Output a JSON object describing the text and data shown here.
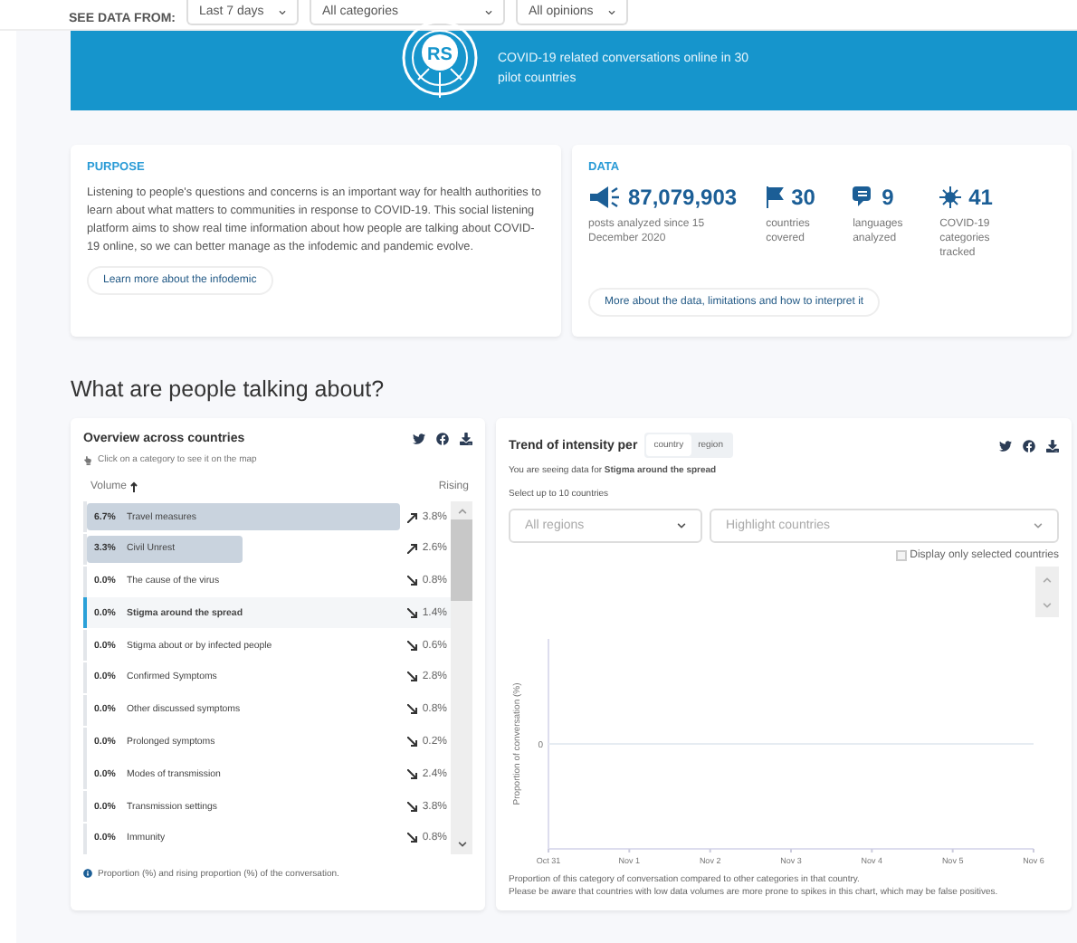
{
  "filter_bar": {
    "label": "SEE DATA FROM:",
    "dropdowns": [
      "Last 7 days",
      "All categories",
      "All opinions"
    ]
  },
  "banner": {
    "logo": "RS",
    "text": "COVID-19 related conversations online in 30 pilot countries"
  },
  "purpose": {
    "title": "PURPOSE",
    "text": "Listening to people's questions and concerns is an important way for health authorities to learn about what matters to communities in response to COVID-19. This social listening platform aims to show real time information about how people are talking about COVID-19 online, so we can better manage as the infodemic and pandemic evolve.",
    "button": "Learn more about the infodemic"
  },
  "data": {
    "title": "DATA",
    "stats": [
      {
        "kind": "posts",
        "value": "87,079,903",
        "label": "posts analyzed since 15 December 2020"
      },
      {
        "kind": "countries",
        "value": "30",
        "label": "countries covered"
      },
      {
        "kind": "languages",
        "value": "9",
        "label": "languages analyzed"
      },
      {
        "kind": "categories",
        "value": "41",
        "label": "COVID-19 categories tracked"
      }
    ],
    "button": "More about the data, limitations and how to interpret it"
  },
  "section_title": "What are people talking about?",
  "overview": {
    "title": "Overview across countries",
    "hint": "Click on a category to see it on the map",
    "volume_header": "Volume",
    "rising_header": "Rising",
    "rows": [
      {
        "percent": "6.7%",
        "label": "Travel measures",
        "level": 0.86,
        "kind": "up",
        "rising": "3.8%",
        "selected": false
      },
      {
        "percent": "3.3%",
        "label": "Civil Unrest",
        "level": 0.43,
        "kind": "up",
        "rising": "2.6%",
        "selected": false
      },
      {
        "percent": "0.0%",
        "label": "The cause of the virus",
        "kind": "down",
        "rising": "0.8%",
        "selected": false
      },
      {
        "percent": "0.0%",
        "label": "Stigma around the spread",
        "kind": "down",
        "rising": "1.4%",
        "selected": true
      },
      {
        "percent": "0.0%",
        "label": "Stigma about or by infected people",
        "kind": "down",
        "rising": "0.6%",
        "selected": false
      },
      {
        "percent": "0.0%",
        "label": "Confirmed Symptoms",
        "kind": "down",
        "rising": "2.8%",
        "selected": false
      },
      {
        "percent": "0.0%",
        "label": "Other discussed symptoms",
        "kind": "down",
        "rising": "0.8%",
        "selected": false
      },
      {
        "percent": "0.0%",
        "label": "Prolonged symptoms",
        "kind": "down",
        "rising": "0.2%",
        "selected": false
      },
      {
        "percent": "0.0%",
        "label": "Modes of transmission",
        "kind": "down",
        "rising": "2.4%",
        "selected": false
      },
      {
        "percent": "0.0%",
        "label": "Transmission settings",
        "kind": "down",
        "rising": "3.8%",
        "selected": false
      },
      {
        "percent": "0.0%",
        "label": "Immunity",
        "kind": "down",
        "rising": "0.8%",
        "selected": false
      }
    ],
    "footnote": "Proportion (%) and rising proportion (%) of the conversation."
  },
  "trend": {
    "title": "Trend of intensity per",
    "toggle": [
      {
        "label": "country",
        "selected": true
      },
      {
        "label": "region",
        "selected": false
      }
    ],
    "seeing_prefix": "You are seeing data for ",
    "seeing_topic": "Stigma around the spread",
    "select_hint": "Select up to 10 countries",
    "region_select": {
      "placeholder": "All regions"
    },
    "country_select": {
      "placeholder": "Highlight countries"
    },
    "only_selected": {
      "label": "Display only selected countries",
      "checked": false
    },
    "chart": {
      "ylabel": "Proportion of conversation (%)",
      "y_tick": "0",
      "x_labels": [
        "Oct 31",
        "Nov 1",
        "Nov 2",
        "Nov 3",
        "Nov 4",
        "Nov 5",
        "Nov 6"
      ]
    },
    "notes": [
      "Proportion of this category of conversation compared to other categories in that country.",
      "Please be aware that countries with low data volumes are more prone to spikes in this chart, which may be false positives."
    ]
  }
}
